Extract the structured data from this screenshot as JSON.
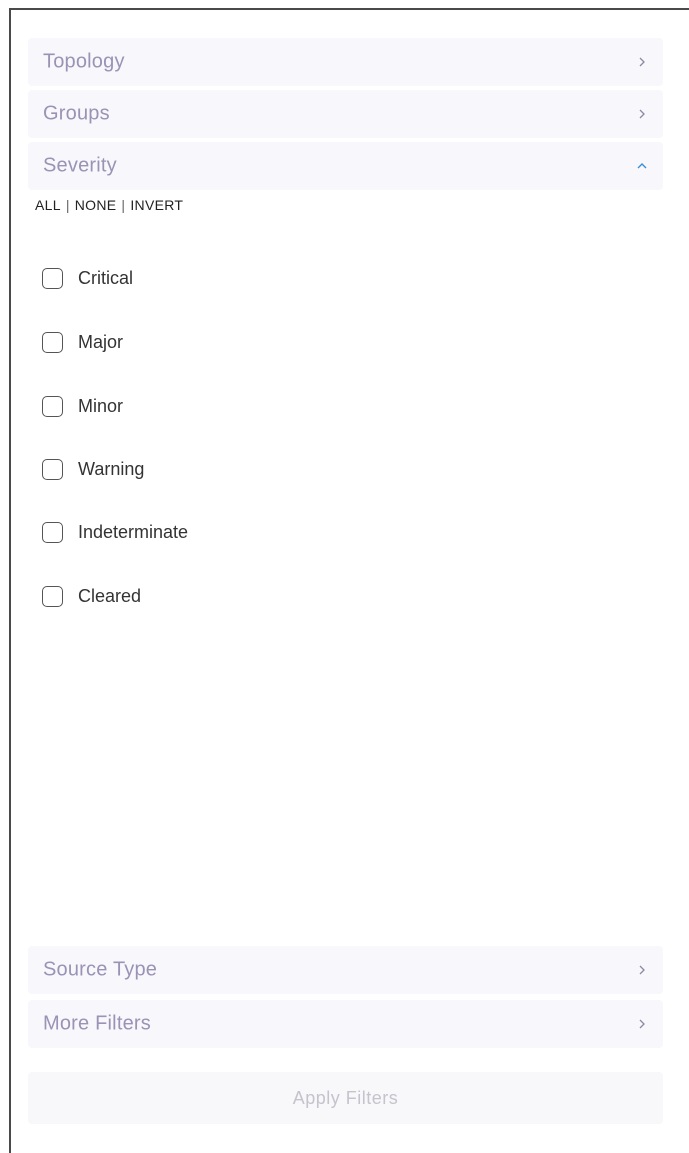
{
  "sections": {
    "topology": {
      "label": "Topology",
      "icon": "chevron-right-icon"
    },
    "groups": {
      "label": "Groups",
      "icon": "chevron-right-icon"
    },
    "severity": {
      "label": "Severity",
      "icon": "chevron-up-icon"
    },
    "source_type": {
      "label": "Source Type",
      "icon": "chevron-right-icon"
    },
    "more_filters": {
      "label": "More Filters",
      "icon": "chevron-right-icon"
    }
  },
  "severity_controls": {
    "all": "ALL",
    "none": "NONE",
    "invert": "INVERT",
    "separator": "|"
  },
  "severity_options": [
    {
      "label": "Critical",
      "checked": false
    },
    {
      "label": "Major",
      "checked": false
    },
    {
      "label": "Minor",
      "checked": false
    },
    {
      "label": "Warning",
      "checked": false
    },
    {
      "label": "Indeterminate",
      "checked": false
    },
    {
      "label": "Cleared",
      "checked": false
    }
  ],
  "apply_button": {
    "label": "Apply Filters",
    "enabled": false
  },
  "colors": {
    "header_bg": "#f8f7fb",
    "header_text": "#9a93b5",
    "chevron_right": "#8a8aa0",
    "chevron_up": "#3b8fd9",
    "apply_text_disabled": "#c5c3cc"
  }
}
